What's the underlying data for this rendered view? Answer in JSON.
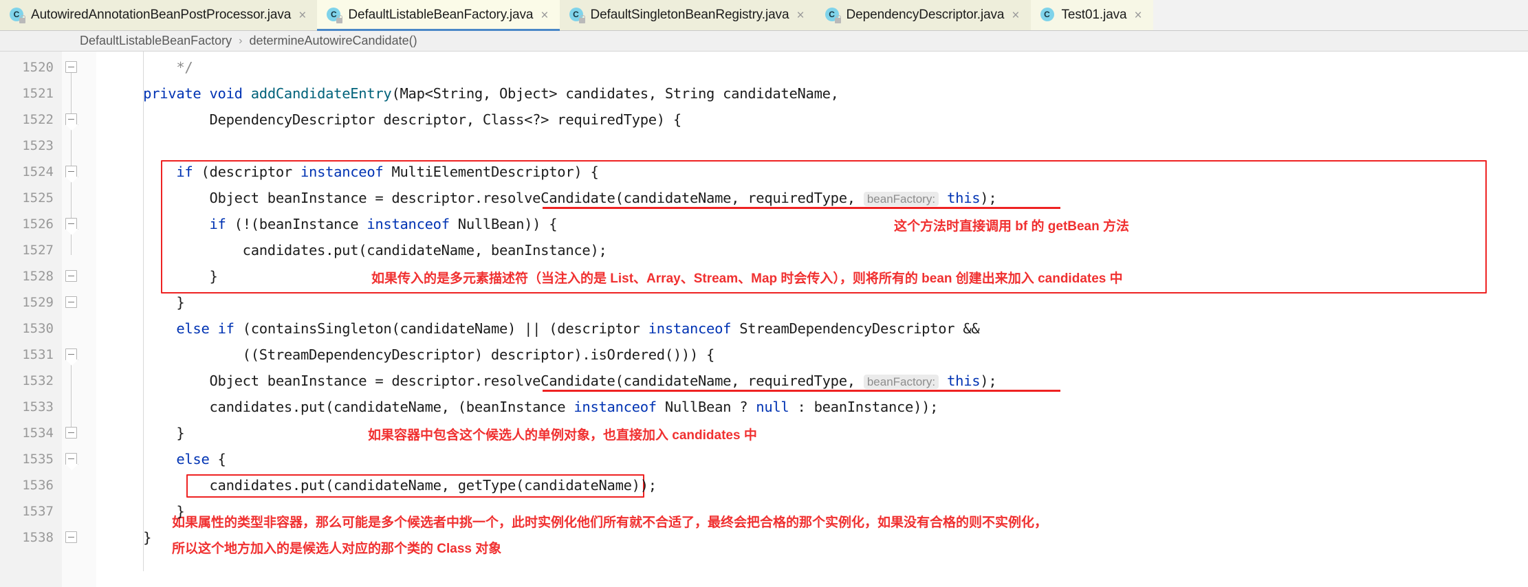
{
  "window": {
    "accent_blue": "#4a88c7",
    "annotation_red": "#f03030",
    "box_red": "#ee2222"
  },
  "tabs": [
    {
      "label": "AutowiredAnnotationBeanPostProcessor.java",
      "icon": "java-class-icon",
      "close": "×",
      "active": false,
      "locked": true
    },
    {
      "label": "DefaultListableBeanFactory.java",
      "icon": "java-class-icon",
      "close": "×",
      "active": true,
      "locked": true
    },
    {
      "label": "DefaultSingletonBeanRegistry.java",
      "icon": "java-class-icon",
      "close": "×",
      "active": false,
      "locked": true
    },
    {
      "label": "DependencyDescriptor.java",
      "icon": "java-class-icon",
      "close": "×",
      "active": false,
      "locked": true
    },
    {
      "label": "Test01.java",
      "icon": "java-class-icon",
      "close": "×",
      "active": false,
      "locked": false
    }
  ],
  "tab_icon_letter": "C",
  "breadcrumb": {
    "separator": "›",
    "items": [
      {
        "label": "DefaultListableBeanFactory"
      },
      {
        "label": "determineAutowireCandidate()"
      }
    ]
  },
  "editor": {
    "first_line_number": 1520,
    "line_numbers": [
      1520,
      1521,
      1522,
      1523,
      1524,
      1525,
      1526,
      1527,
      1528,
      1529,
      1530,
      1531,
      1532,
      1533,
      1534,
      1535,
      1536,
      1537,
      1538
    ],
    "lines": [
      {
        "n": 1520,
        "segments": [
          {
            "t": "        */",
            "c": "cmt"
          }
        ]
      },
      {
        "n": 1521,
        "segments": [
          {
            "t": "    ",
            "c": ""
          },
          {
            "t": "private ",
            "c": "kw"
          },
          {
            "t": "void ",
            "c": "kw"
          },
          {
            "t": "addCandidateEntry",
            "c": "mth"
          },
          {
            "t": "(Map<String, Object> candidates, String candidateName,",
            "c": ""
          }
        ]
      },
      {
        "n": 1522,
        "segments": [
          {
            "t": "            DependencyDescriptor descriptor, Class<?> requiredType) {",
            "c": ""
          }
        ]
      },
      {
        "n": 1523,
        "segments": [
          {
            "t": "",
            "c": ""
          }
        ]
      },
      {
        "n": 1524,
        "segments": [
          {
            "t": "        ",
            "c": ""
          },
          {
            "t": "if",
            "c": "kw"
          },
          {
            "t": " (descriptor ",
            "c": ""
          },
          {
            "t": "instanceof",
            "c": "kw"
          },
          {
            "t": " MultiElementDescriptor) {",
            "c": ""
          }
        ]
      },
      {
        "n": 1525,
        "segments": [
          {
            "t": "            Object beanInstance = descriptor.resolveCandidate(candidateName, requiredType, ",
            "c": ""
          },
          {
            "t": "beanFactory:",
            "c": "hint"
          },
          {
            "t": " ",
            "c": ""
          },
          {
            "t": "this",
            "c": "kw"
          },
          {
            "t": ");",
            "c": ""
          }
        ]
      },
      {
        "n": 1526,
        "segments": [
          {
            "t": "            ",
            "c": ""
          },
          {
            "t": "if",
            "c": "kw"
          },
          {
            "t": " (!(beanInstance ",
            "c": ""
          },
          {
            "t": "instanceof",
            "c": "kw"
          },
          {
            "t": " NullBean)) {",
            "c": ""
          }
        ]
      },
      {
        "n": 1527,
        "segments": [
          {
            "t": "                candidates.put(candidateName, beanInstance);",
            "c": ""
          }
        ]
      },
      {
        "n": 1528,
        "segments": [
          {
            "t": "            }",
            "c": ""
          }
        ]
      },
      {
        "n": 1529,
        "segments": [
          {
            "t": "        }",
            "c": ""
          }
        ]
      },
      {
        "n": 1530,
        "segments": [
          {
            "t": "        ",
            "c": ""
          },
          {
            "t": "else",
            "c": "kw"
          },
          {
            "t": " ",
            "c": ""
          },
          {
            "t": "if",
            "c": "kw"
          },
          {
            "t": " (containsSingleton(candidateName) || (descriptor ",
            "c": ""
          },
          {
            "t": "instanceof",
            "c": "kw"
          },
          {
            "t": " StreamDependencyDescriptor &&",
            "c": ""
          }
        ]
      },
      {
        "n": 1531,
        "segments": [
          {
            "t": "                ((StreamDependencyDescriptor) descriptor).isOrdered())) {",
            "c": ""
          }
        ]
      },
      {
        "n": 1532,
        "segments": [
          {
            "t": "            Object beanInstance = descriptor.resolveCandidate(candidateName, requiredType, ",
            "c": ""
          },
          {
            "t": "beanFactory:",
            "c": "hint"
          },
          {
            "t": " ",
            "c": ""
          },
          {
            "t": "this",
            "c": "kw"
          },
          {
            "t": ");",
            "c": ""
          }
        ]
      },
      {
        "n": 1533,
        "segments": [
          {
            "t": "            candidates.put(candidateName, (beanInstance ",
            "c": ""
          },
          {
            "t": "instanceof",
            "c": "kw"
          },
          {
            "t": " NullBean ? ",
            "c": ""
          },
          {
            "t": "null",
            "c": "kw"
          },
          {
            "t": " : beanInstance));",
            "c": ""
          }
        ]
      },
      {
        "n": 1534,
        "segments": [
          {
            "t": "        }",
            "c": ""
          }
        ]
      },
      {
        "n": 1535,
        "segments": [
          {
            "t": "        ",
            "c": ""
          },
          {
            "t": "else",
            "c": "kw"
          },
          {
            "t": " {",
            "c": ""
          }
        ]
      },
      {
        "n": 1536,
        "segments": [
          {
            "t": "            candidates.put(candidateName, getType(candidateName));",
            "c": ""
          }
        ]
      },
      {
        "n": 1537,
        "segments": [
          {
            "t": "        }",
            "c": ""
          }
        ]
      },
      {
        "n": 1538,
        "segments": [
          {
            "t": "    }",
            "c": ""
          }
        ]
      }
    ]
  },
  "annotations": [
    {
      "id": "anno-getbean",
      "text": "这个方法时直接调用 bf 的 getBean 方法"
    },
    {
      "id": "anno-multi",
      "text": "如果传入的是多元素描述符（当注入的是 List、Array、Stream、Map 时会传入），则将所有的 bean 创建出来加入 candidates 中"
    },
    {
      "id": "anno-singleton",
      "text": "如果容器中包含这个候选人的单例对象，也直接加入 candidates 中"
    },
    {
      "id": "anno-class-1",
      "text": "如果属性的类型非容器，那么可能是多个候选者中挑一个，此时实例化他们所有就不合适了，最终会把合格的那个实例化，如果没有合格的则不实例化，"
    },
    {
      "id": "anno-class-2",
      "text": "所以这个地方加入的是候选人对应的那个类的 Class 对象"
    }
  ]
}
